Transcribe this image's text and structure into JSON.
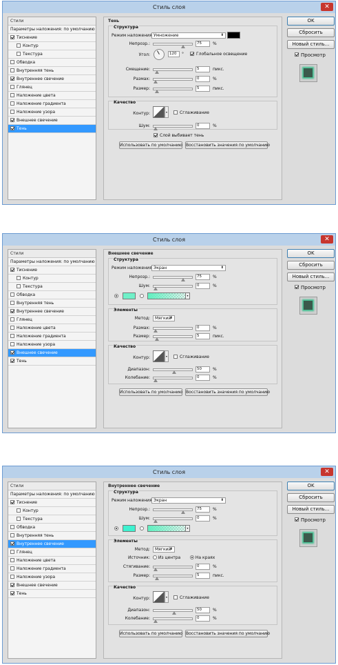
{
  "window_title": "Стиль слоя",
  "close_symbol": "✕",
  "right_buttons": {
    "ok": "OK",
    "reset": "Сбросить",
    "new_style": "Новый стиль...",
    "preview": "Просмотр"
  },
  "left_panel": {
    "header": "Стили",
    "blend_options": "Параметры наложения: по умолчанию",
    "items": [
      "Тиснение",
      "Контур",
      "Текстура",
      "Обводка",
      "Внутренняя тень",
      "Внутреннее свечение",
      "Глянец",
      "Наложение цвета",
      "Наложение градиента",
      "Наложение узора",
      "Внешнее свечение",
      "Тень"
    ]
  },
  "units": {
    "percent": "%",
    "px": "пикс.",
    "degree": "°"
  },
  "footer": {
    "default_btn": "Использовать по умолчанию",
    "restore_btn": "Восстановить значения по умолчанию"
  },
  "quality": {
    "title": "Качество",
    "contour": "Контур:",
    "antialias": "Сглаживание",
    "noise": "Шум:",
    "range": "Диапазон:",
    "jitter": "Колебание:"
  },
  "dialogs": [
    {
      "section": "Тень",
      "structure_title": "Структура",
      "blend_label": "Режим наложения:",
      "blend_value": "Умножение",
      "swatch_color": "#000000",
      "opacity_label": "Непрозр.:",
      "opacity": "75",
      "opacity_fraction": 0.75,
      "angle_label": "Угол:",
      "angle": "120",
      "global_light": "Глобальное освещение",
      "distance_label": "Смещение:",
      "distance": "5",
      "spread_label": "Размах:",
      "spread": "0",
      "size_label": "Размер:",
      "size": "5",
      "noise": "0",
      "knockout": "Слой выбивает тень",
      "checked": [
        true,
        false,
        false,
        false,
        false,
        true,
        false,
        false,
        false,
        false,
        true,
        true
      ],
      "selected_index": 11
    },
    {
      "section": "Внешнее свечение",
      "structure_title": "Структура",
      "blend_label": "Режим наложения:",
      "blend_value": "Экран",
      "opacity_label": "Непрозр.:",
      "opacity": "75",
      "noise_label": "Шум:",
      "noise": "0",
      "color": "#6ff0c8",
      "elements_title": "Элементы",
      "method_label": "Метод:",
      "method": "Мягкий",
      "spread_label": "Размах:",
      "spread": "0",
      "size_label": "Размер:",
      "size": "5",
      "range": "50",
      "jitter": "0",
      "checked": [
        true,
        false,
        false,
        false,
        false,
        true,
        false,
        false,
        false,
        false,
        true,
        true
      ],
      "selected_index": 10
    },
    {
      "section": "Внутреннее свечение",
      "structure_title": "Структура",
      "blend_label": "Режим наложения:",
      "blend_value": "Экран",
      "opacity_label": "Непрозр.:",
      "opacity": "75",
      "noise_label": "Шум:",
      "noise": "0",
      "color": "#3ef2d0",
      "elements_title": "Элементы",
      "method_label": "Метод:",
      "method": "Мягкий",
      "source_label": "Источник:",
      "source_center": "Из центра",
      "source_edge": "На краях",
      "choke_label": "Стягивание:",
      "choke": "0",
      "size_label": "Размер:",
      "size": "5",
      "range": "50",
      "jitter": "0",
      "checked": [
        true,
        false,
        false,
        false,
        false,
        true,
        false,
        false,
        false,
        false,
        true,
        true
      ],
      "selected_index": 5
    }
  ]
}
